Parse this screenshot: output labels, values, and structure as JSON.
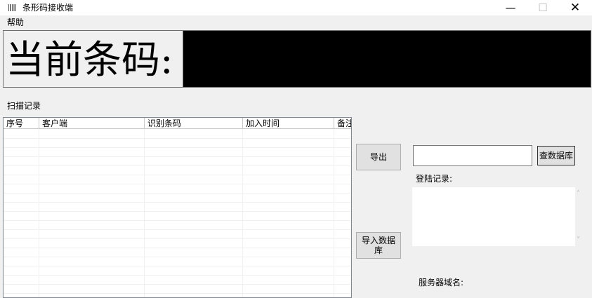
{
  "window": {
    "title": "条形码接收端",
    "controls": {
      "minimize": "—",
      "maximize": "☐",
      "close": "✕"
    }
  },
  "menu": {
    "help": "帮助"
  },
  "barcode": {
    "label": "当前条码:",
    "value": ""
  },
  "scan_records": {
    "label": "扫描记录",
    "columns": [
      "序号",
      "客户端",
      "识别条码",
      "加入时间",
      "备注"
    ],
    "rows": []
  },
  "buttons": {
    "export": "导出",
    "import_db": "导入数据库",
    "query_db": "查数据库"
  },
  "query": {
    "value": ""
  },
  "login_records": {
    "label": "登陆记录:",
    "content": ""
  },
  "server": {
    "label": "服务器域名:"
  },
  "icons": {
    "app": "barcode-icon",
    "scroll_up": "chevron-up-icon",
    "scroll_down": "chevron-down-icon"
  }
}
